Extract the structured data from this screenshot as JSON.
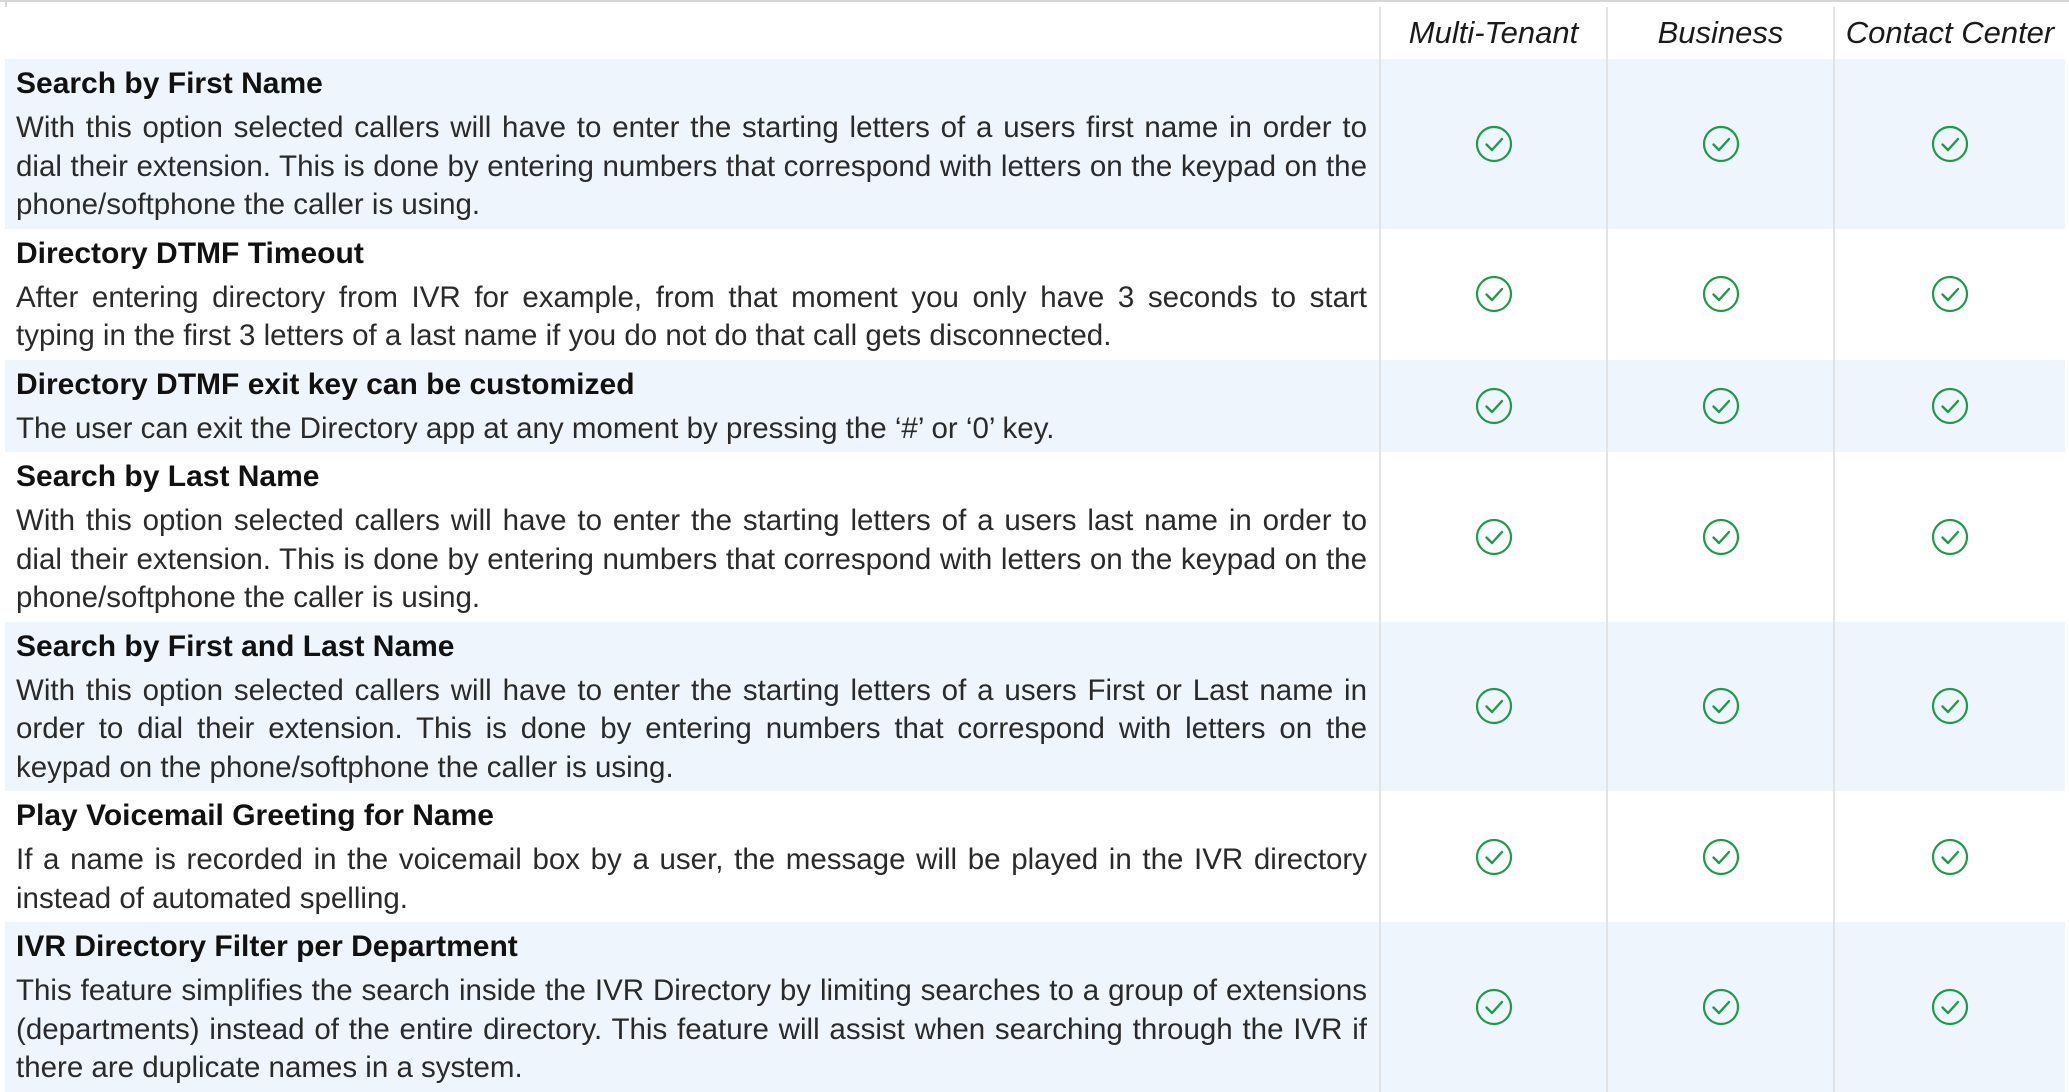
{
  "header": {
    "editions": [
      "Multi-Tenant",
      "Business",
      "Contact Center"
    ]
  },
  "colors": {
    "check": "#1f9a4a",
    "row_shade": "#eef5fd"
  },
  "icons": {
    "included": "check-circle-icon"
  },
  "features": [
    {
      "title": "Search by First Name",
      "description": "With this option selected callers will have to enter the starting letters of a users first name in order to dial their extension. This is done by entering numbers that correspond with letters on the keypad on the phone/softphone the caller is using.",
      "available": [
        true,
        true,
        true
      ]
    },
    {
      "title": "Directory DTMF Timeout",
      "description": "After entering directory from IVR for example, from that moment you only have 3 seconds to start typing in the first 3 letters of a last name if you do not do that call gets disconnected.",
      "available": [
        true,
        true,
        true
      ]
    },
    {
      "title": "Directory DTMF exit key can be customized",
      "description": "The user can exit the Directory app at any moment by pressing the ‘#’ or ‘0’ key.",
      "available": [
        true,
        true,
        true
      ]
    },
    {
      "title": "Search by Last Name",
      "description": "With this option selected callers will have to enter the starting letters of a users last name in order to dial their extension. This is done by entering numbers that correspond with letters on the keypad on the phone/softphone the caller is using.",
      "available": [
        true,
        true,
        true
      ]
    },
    {
      "title": "Search by First and Last Name",
      "description": "With this option selected callers will have to enter the starting letters of a users First or Last name in order to dial their extension. This is done by entering numbers that correspond with letters on the keypad on the phone/softphone the caller is using.",
      "available": [
        true,
        true,
        true
      ]
    },
    {
      "title": "Play Voicemail Greeting for Name",
      "description": "If a name is recorded in the voicemail box by a user, the message will be played in the IVR directory instead of automated spelling.",
      "available": [
        true,
        true,
        true
      ]
    },
    {
      "title": "IVR Directory Filter per Department",
      "description": "This feature simplifies the search inside the IVR Directory by limiting searches to a group of extensions (departments) instead of the entire directory. This feature will assist when searching through the IVR if there are duplicate names in a system.",
      "available": [
        true,
        true,
        true
      ]
    }
  ]
}
